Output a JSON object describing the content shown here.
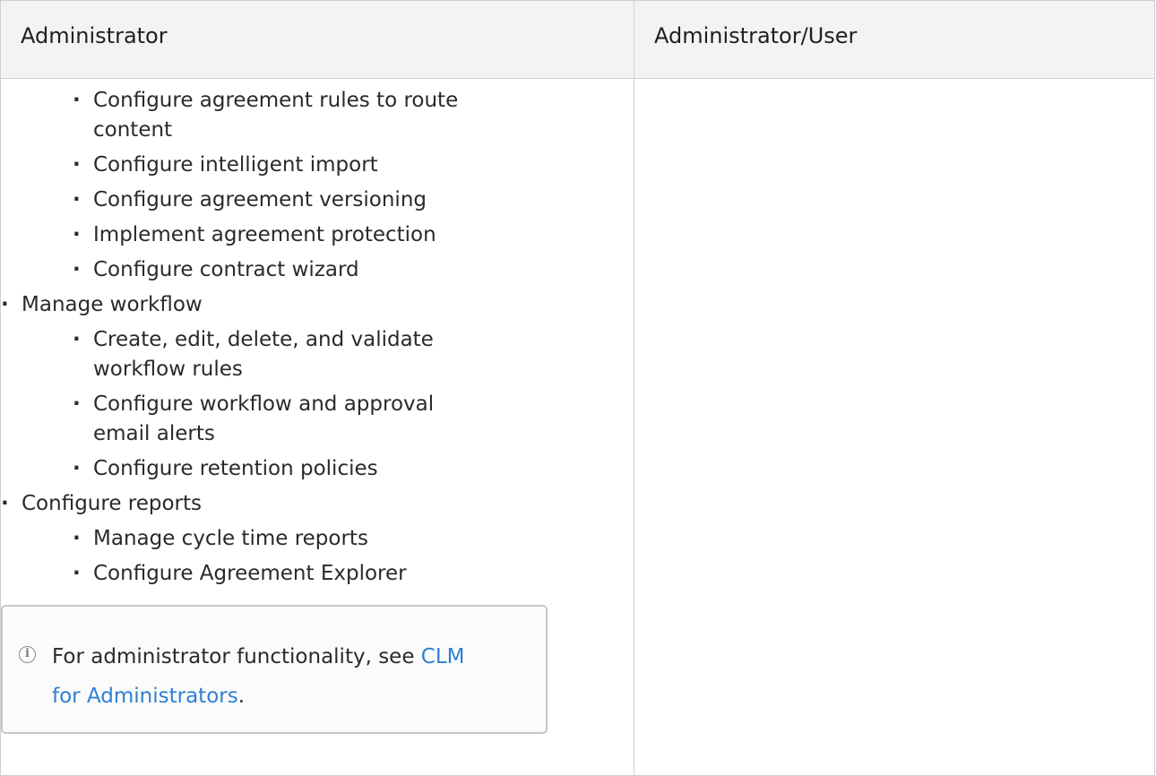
{
  "table": {
    "headers": [
      "Administrator",
      "Administrator/User"
    ]
  },
  "items": [
    {
      "level": 2,
      "text": "Configure agreement rules to route"
    },
    {
      "level": 2,
      "text": "content",
      "continuation": true
    },
    {
      "level": 2,
      "text": "Configure intelligent import"
    },
    {
      "level": 2,
      "text": "Configure agreement versioning"
    },
    {
      "level": 2,
      "text": "Implement agreement protection"
    },
    {
      "level": 2,
      "text": "Configure contract wizard"
    },
    {
      "level": 1,
      "text": "Manage workflow"
    },
    {
      "level": 2,
      "text": "Create, edit, delete, and validate"
    },
    {
      "level": 2,
      "text": "workflow rules",
      "continuation": true
    },
    {
      "level": 2,
      "text": "Configure workflow and approval"
    },
    {
      "level": 2,
      "text": "email alerts",
      "continuation": true
    },
    {
      "level": 2,
      "text": "Configure retention policies"
    },
    {
      "level": 1,
      "text": "Configure reports"
    },
    {
      "level": 2,
      "text": "Manage cycle time reports"
    },
    {
      "level": 2,
      "text": "Configure Agreement Explorer"
    }
  ],
  "info_note": {
    "icon": "info-circle-icon",
    "text_before": "For administrator functionality, see ",
    "link_line1": "CLM",
    "link_line2": "for Administrators",
    "text_after": "."
  }
}
